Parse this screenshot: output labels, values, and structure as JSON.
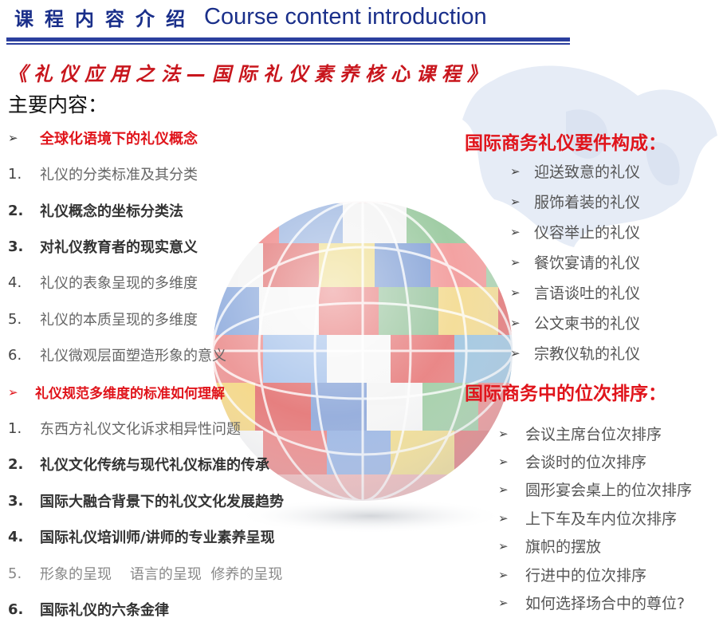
{
  "header": {
    "title_cn": "课程内容介绍",
    "title_en": "Course content introduction"
  },
  "course_title": "《礼仪应用之法—国际礼仪素养核心课程》",
  "subtitle": "主要内容：",
  "left_items": [
    {
      "marker": "➢",
      "text": "全球化语境下的礼仪概念",
      "style": "red"
    },
    {
      "marker": "1.",
      "text": "礼仪的分类标准及其分类",
      "style": "normal"
    },
    {
      "marker": "2.",
      "text": "礼仪概念的坐标分类法",
      "style": "bold"
    },
    {
      "marker": "3.",
      "text": "对礼仪教育者的现实意义",
      "style": "bold"
    },
    {
      "marker": "4.",
      "text": "礼仪的表象呈现的多维度",
      "style": "normal"
    },
    {
      "marker": "5.",
      "text": "礼仪的本质呈现的多维度",
      "style": "normal"
    },
    {
      "marker": "6.",
      "text": "礼仪微观层面塑造形象的意义",
      "style": "normal"
    },
    {
      "marker": "➢",
      "text": "礼仪规范多维度的标准如何理解",
      "style": "red"
    },
    {
      "marker": "1.",
      "text": "东西方礼仪文化诉求相异性问题",
      "style": "normal"
    },
    {
      "marker": "2.",
      "text": "礼仪文化传统与现代礼仪标准的传承",
      "style": "bold"
    },
    {
      "marker": "3.",
      "text": "国际大融合背景下的礼仪文化发展趋势",
      "style": "bold"
    },
    {
      "marker": "4.",
      "text": "国际礼仪培训师/讲师的专业素养呈现",
      "style": "bold"
    },
    {
      "marker": "5.",
      "text": "形象的呈现    语言的呈现  修养的呈现",
      "style": "normal"
    },
    {
      "marker": "6.",
      "text": "国际礼仪的六条金律",
      "style": "bold"
    }
  ],
  "right_section1": {
    "heading": "国际商务礼仪要件构成：",
    "items": [
      "迎送致意的礼仪",
      "服饰着装的礼仪",
      "仪容举止的礼仪",
      "餐饮宴请的礼仪",
      "言语谈吐的礼仪",
      "公文柬书的礼仪",
      "宗教仪轨的礼仪"
    ]
  },
  "right_section2": {
    "heading": "国际商务中的位次排序：",
    "items": [
      "会议主席台位次排序",
      "会谈时的位次排序",
      "圆形宴会桌上的位次排序",
      "上下车及车内位次排序",
      "旗帜的摆放",
      "行进中的位次排序",
      "如何选择场合中的尊位?"
    ]
  },
  "colors": {
    "brand_blue": "#1a2f8a",
    "accent_red": "#e0141b",
    "course_red": "#c8161d"
  }
}
